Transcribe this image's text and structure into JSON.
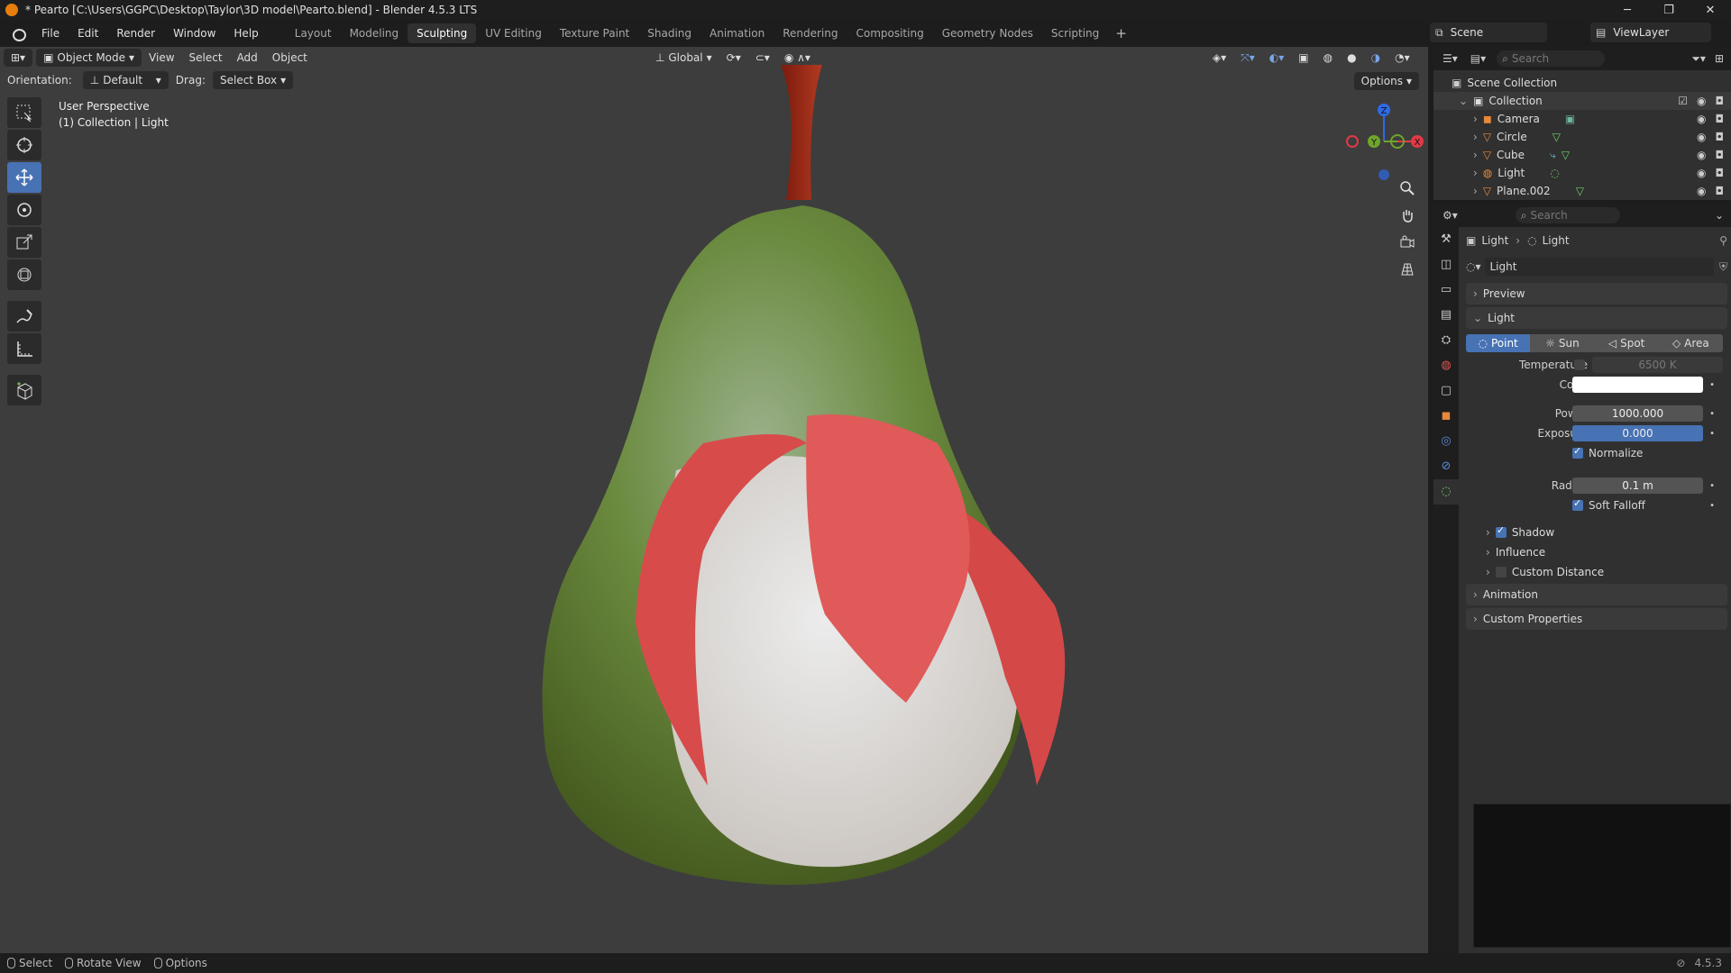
{
  "window": {
    "title": "* Pearto [C:\\Users\\GGPC\\Desktop\\Taylor\\3D model\\Pearto.blend] - Blender 4.5.3 LTS"
  },
  "menu": [
    "File",
    "Edit",
    "Render",
    "Window",
    "Help"
  ],
  "workspaces": [
    {
      "label": "Layout",
      "active": false
    },
    {
      "label": "Modeling",
      "active": false
    },
    {
      "label": "Sculpting",
      "active": true
    },
    {
      "label": "UV Editing",
      "active": false
    },
    {
      "label": "Texture Paint",
      "active": false
    },
    {
      "label": "Shading",
      "active": false
    },
    {
      "label": "Animation",
      "active": false
    },
    {
      "label": "Rendering",
      "active": false
    },
    {
      "label": "Compositing",
      "active": false
    },
    {
      "label": "Geometry Nodes",
      "active": false
    },
    {
      "label": "Scripting",
      "active": false
    }
  ],
  "scene": {
    "name": "Scene",
    "view_layer": "ViewLayer"
  },
  "viewport": {
    "mode": "Object Mode",
    "menus": [
      "View",
      "Select",
      "Add",
      "Object"
    ],
    "transform_orientation": "Global",
    "orientation_label": "Orientation:",
    "orientation_value": "Default",
    "drag_label": "Drag:",
    "drag_value": "Select Box",
    "options": "Options",
    "info_line1": "User Perspective",
    "info_line2": "(1) Collection | Light",
    "gizmo": {
      "z": "Z",
      "y": "Y",
      "x": "X"
    }
  },
  "outliner": {
    "search_placeholder": "Search",
    "scene_collection": "Scene Collection",
    "collection": "Collection",
    "items": [
      "Camera",
      "Circle",
      "Cube",
      "Light",
      "Plane.002"
    ]
  },
  "properties": {
    "search_placeholder": "Search",
    "breadcrumb_object": "Light",
    "breadcrumb_data": "Light",
    "datablock": "Light",
    "sections": {
      "preview": "Preview",
      "light": "Light",
      "shadow": "Shadow",
      "influence": "Influence",
      "custom_distance": "Custom Distance",
      "animation": "Animation",
      "custom_properties": "Custom Properties"
    },
    "light_types": [
      {
        "label": "Point",
        "active": true
      },
      {
        "label": "Sun",
        "active": false
      },
      {
        "label": "Spot",
        "active": false
      },
      {
        "label": "Area",
        "active": false
      }
    ],
    "temperature_label": "Temperature",
    "temperature_value": "6500 K",
    "color_label": "Color",
    "color_value": "#ffffff",
    "power_label": "Power",
    "power_value": "1000.000",
    "exposure_label": "Exposure",
    "exposure_value": "0.000",
    "normalize_label": "Normalize",
    "radius_label": "Radius",
    "radius_value": "0.1 m",
    "soft_falloff_label": "Soft Falloff"
  },
  "statusbar": {
    "select": "Select",
    "rotate": "Rotate View",
    "options": "Options",
    "version": "4.5.3"
  },
  "colors": {
    "accent": "#4772b3",
    "background": "#3d3d3d",
    "pear_green": "#6f8a3e",
    "petal_red": "#d84c4c"
  }
}
